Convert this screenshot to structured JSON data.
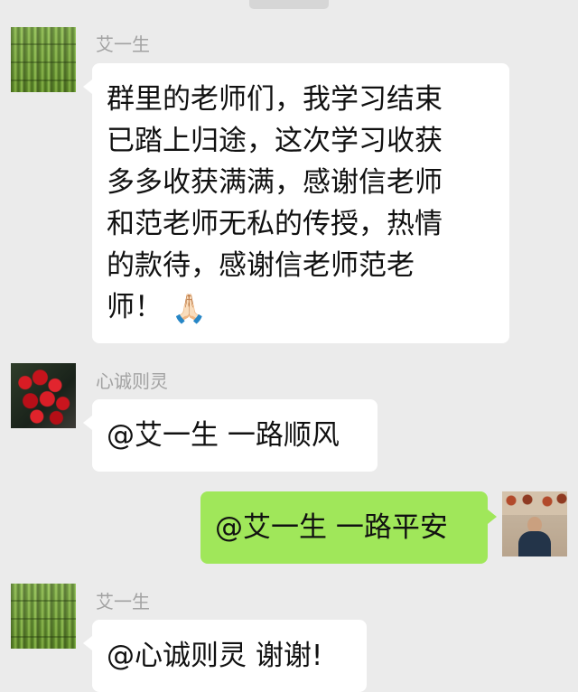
{
  "messages": [
    {
      "sender": "艾一生",
      "lines": [
        "群里的老师们，我学习结束",
        "已踏上归途，这次学习收获",
        "多多收获满满，感谢信老师",
        "和范老师无私的传授，热情",
        "的款待，感谢信老师范老",
        "师！"
      ],
      "emoji": "🙏🏻"
    },
    {
      "sender": "心诚则灵",
      "text": "@艾一生 一路顺风"
    },
    {
      "text": "@艾一生 一路平安"
    },
    {
      "sender": "艾一生",
      "text": "@心诚则灵 谢谢!"
    }
  ],
  "avatars": [
    {
      "icon": "bamboo-avatar"
    },
    {
      "icon": "roses-avatar"
    },
    {
      "icon": "self-portrait-avatar"
    },
    {
      "icon": "bamboo-avatar"
    }
  ],
  "colors": {
    "background": "#ebebeb",
    "incoming_bubble": "#ffffff",
    "outgoing_bubble": "#a0e75a",
    "sender_name": "#a2a2a2"
  }
}
